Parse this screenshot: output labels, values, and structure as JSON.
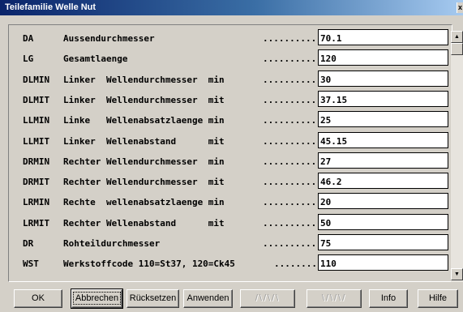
{
  "window": {
    "title": "Teilefamilie Welle Nut",
    "close_glyph": "x"
  },
  "rows": [
    {
      "code": "DA",
      "desc": "Aussendurchmesser",
      "dots": "..........",
      "value": "70.1"
    },
    {
      "code": "LG",
      "desc": "Gesamtlaenge",
      "dots": "..........",
      "value": "120"
    },
    {
      "code": "DLMIN",
      "desc": "Linker  Wellendurchmesser  min",
      "dots": "..........",
      "value": "30"
    },
    {
      "code": "DLMIT",
      "desc": "Linker  Wellendurchmesser  mit",
      "dots": "..........",
      "value": "37.15"
    },
    {
      "code": "LLMIN",
      "desc": "Linke   Wellenabsatzlaenge min",
      "dots": "..........",
      "value": "25"
    },
    {
      "code": "LLMIT",
      "desc": "Linker  Wellenabstand      mit",
      "dots": "..........",
      "value": "45.15"
    },
    {
      "code": "DRMIN",
      "desc": "Rechter Wellendurchmesser  min",
      "dots": "..........",
      "value": "27"
    },
    {
      "code": "DRMIT",
      "desc": "Rechter Wellendurchmesser  mit",
      "dots": "..........",
      "value": "46.2"
    },
    {
      "code": "LRMIN",
      "desc": "Rechte  wellenabsatzlaenge min",
      "dots": "..........",
      "value": "20"
    },
    {
      "code": "LRMIT",
      "desc": "Rechter Wellenabstand      mit",
      "dots": "..........",
      "value": "50"
    },
    {
      "code": "DR",
      "desc": "Rohteildurchmesser",
      "dots": "..........",
      "value": "75"
    },
    {
      "code": "WST",
      "desc": "Werkstoffcode 110=St37, 120=Ck45",
      "dots": "........",
      "value": "110"
    }
  ],
  "buttons": {
    "ok": "OK",
    "cancel": "Abbrechen",
    "reset": "Rücksetzen",
    "apply": "Anwenden",
    "up": "/\\/\\/\\",
    "down": "\\/\\/\\/",
    "info": "Info",
    "help": "Hilfe"
  },
  "scrollbar": {
    "up_glyph": "▲",
    "down_glyph": "▼"
  }
}
